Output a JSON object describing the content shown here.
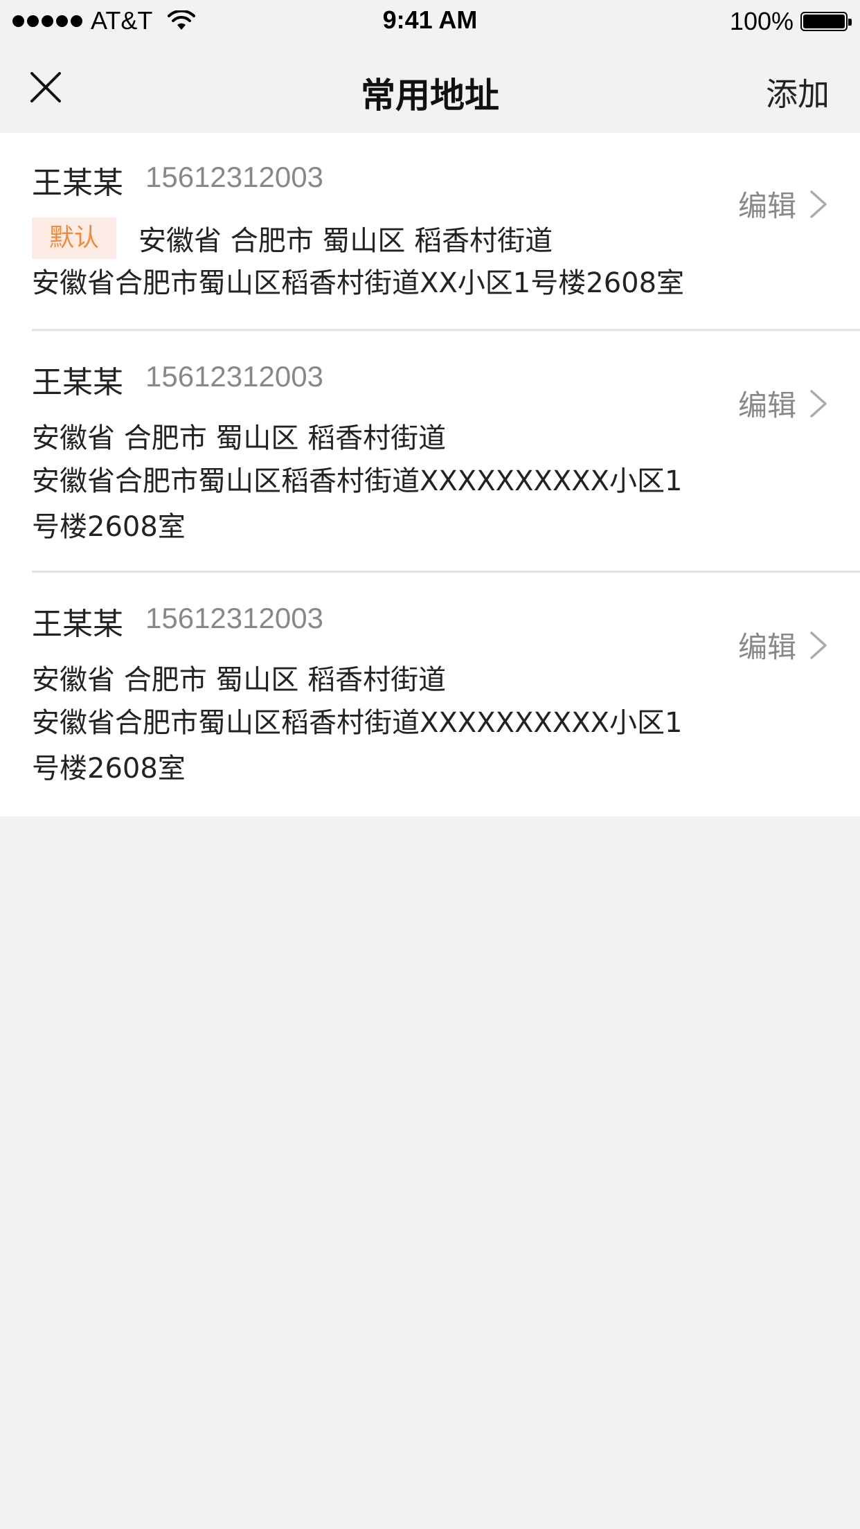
{
  "status_bar": {
    "carrier": "AT&T",
    "time": "9:41 AM",
    "battery": "100%"
  },
  "nav": {
    "title": "常用地址",
    "add_label": "添加"
  },
  "addresses": [
    {
      "name": "王某某",
      "phone": "15612312003",
      "default_badge": "默认",
      "region": "安徽省 合肥市 蜀山区 稻香村街道",
      "address": "安徽省合肥市蜀山区稻香村街道XX小区1号楼2608室",
      "edit_label": "编辑"
    },
    {
      "name": "王某某",
      "phone": "15612312003",
      "region": "安徽省 合肥市 蜀山区 稻香村街道",
      "address_line1": "安徽省合肥市蜀山区稻香村街道XXXXXXXXXX小区1",
      "address_line2": "号楼2608室",
      "edit_label": "编辑"
    },
    {
      "name": "王某某",
      "phone": "15612312003",
      "region": "安徽省 合肥市 蜀山区 稻香村街道",
      "address_line1": "安徽省合肥市蜀山区稻香村街道XXXXXXXXXX小区1",
      "address_line2": "号楼2608室",
      "edit_label": "编辑"
    }
  ],
  "colors": {
    "background": "#f2f2f2",
    "badge_text": "#f08a3c",
    "badge_bg": "#fdebe5",
    "secondary_text": "#888888"
  },
  "icons": [
    "signal-dots-icon",
    "wifi-icon",
    "battery-icon",
    "close-icon",
    "chevron-right-icon"
  ]
}
